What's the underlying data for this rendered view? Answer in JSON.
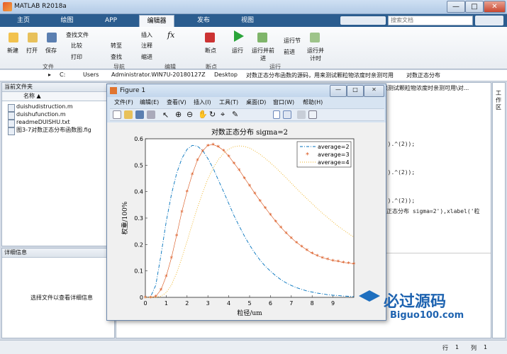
{
  "window": {
    "title": "MATLAB R2018a",
    "minimize": "—",
    "maximize": "□",
    "close": "✕"
  },
  "tabs": [
    {
      "label": "主页",
      "active": false
    },
    {
      "label": "绘图",
      "active": false
    },
    {
      "label": "APP",
      "active": false
    },
    {
      "label": "编辑器",
      "active": true
    },
    {
      "label": "发布",
      "active": false
    },
    {
      "label": "视图",
      "active": false
    }
  ],
  "search_placeholder": "搜索文档",
  "ribbon": {
    "new": "新建",
    "open": "打开",
    "save": "保存",
    "find_files": "查找文件",
    "compare": "比较",
    "print": "打印",
    "goto": "转至",
    "find": "查找",
    "insert": "插入",
    "comment": "注释",
    "indent": "缩进",
    "breakpoint": "断点",
    "run": "运行",
    "run_advance": "运行并前进",
    "run_section": "运行节",
    "advance": "前进",
    "run_time": "运行并计时",
    "groups": {
      "file": "文件",
      "navigate": "导航",
      "edit": "编辑",
      "breakpoints": "断点",
      "run": "运行"
    }
  },
  "address": {
    "parts": [
      "C:",
      "Users",
      "Administrator.WIN7U-20180127Z",
      "Desktop",
      "对数正态分布函数的源码，用来测试颗粒物浓度时亲测可用",
      "对数正态分布"
    ]
  },
  "current_folder": {
    "title": "当前文件夹",
    "column": "名称 ▲",
    "files": [
      "duishudistruction.m",
      "duishufunction.m",
      "readmeDUISHU.txt",
      "图3-7对数正态分布函数图.fig"
    ]
  },
  "details": {
    "title": "详细信息",
    "hint": "选择文件以查看详细信息"
  },
  "editor": {
    "tab_title": "来测试颗粒物浓度时亲测可用\\对...",
    "lines": [
      "d)).^(2));",
      "d)).^(2));",
      "d)).^(2));",
      "数正态分布 sigma=2'),xlabel('粒"
    ]
  },
  "workspace": {
    "label": "工作区"
  },
  "figure": {
    "title": "Figure 1",
    "menus": [
      "文件(F)",
      "编辑(E)",
      "查看(V)",
      "插入(I)",
      "工具(T)",
      "桌面(D)",
      "窗口(W)",
      "帮助(H)"
    ]
  },
  "status": {
    "row_label": "行",
    "row": "1",
    "col_label": "列",
    "col": "1"
  },
  "watermark": {
    "brand": "必过源码",
    "site": "Biguo100.com"
  },
  "chart_data": {
    "type": "line",
    "title": "对数正态分布 sigma=2",
    "xlabel": "粒径/um",
    "ylabel": "权重/100%",
    "xlim": [
      0,
      10
    ],
    "ylim": [
      0,
      0.6
    ],
    "xticks": [
      0,
      1,
      2,
      3,
      4,
      5,
      6,
      7,
      8,
      9
    ],
    "yticks": [
      0,
      0.1,
      0.2,
      0.3,
      0.4,
      0.5,
      0.6
    ],
    "legend_position": "top-right",
    "x": [
      0,
      0.25,
      0.5,
      0.75,
      1,
      1.25,
      1.5,
      1.75,
      2,
      2.25,
      2.5,
      2.75,
      3,
      3.25,
      3.5,
      3.75,
      4,
      4.25,
      4.5,
      4.75,
      5,
      5.25,
      5.5,
      5.75,
      6,
      6.25,
      6.5,
      6.75,
      7,
      7.25,
      7.5,
      7.75,
      8,
      8.25,
      8.5,
      8.75,
      9,
      9.25,
      9.5,
      9.75,
      10
    ],
    "series": [
      {
        "name": "average=2",
        "color": "#0072bd",
        "style": "dashdot",
        "values": [
          0,
          0.0022,
          0.046,
          0.16,
          0.286,
          0.39,
          0.469,
          0.525,
          0.56,
          0.575,
          0.572,
          0.555,
          0.525,
          0.488,
          0.444,
          0.4,
          0.355,
          0.31,
          0.27,
          0.232,
          0.198,
          0.168,
          0.141,
          0.118,
          0.099,
          0.082,
          0.067,
          0.055,
          0.045,
          0.037,
          0.03,
          0.024,
          0.02,
          0.016,
          0.013,
          0.01,
          0.008,
          0.007,
          0.005,
          0.004,
          0.003
        ]
      },
      {
        "name": "average=3",
        "color": "#d95319",
        "style": "star",
        "values": [
          0,
          0.0001,
          0.004,
          0.029,
          0.08,
          0.15,
          0.235,
          0.324,
          0.4,
          0.466,
          0.52,
          0.555,
          0.575,
          0.578,
          0.57,
          0.556,
          0.534,
          0.508,
          0.482,
          0.452,
          0.423,
          0.394,
          0.366,
          0.339,
          0.313,
          0.288,
          0.265,
          0.244,
          0.225,
          0.208,
          0.193,
          0.179,
          0.167,
          0.158,
          0.15,
          0.145,
          0.139,
          0.136,
          0.132,
          0.13,
          0.127
        ]
      },
      {
        "name": "average=4",
        "color": "#edb120",
        "style": "dotted",
        "values": [
          0,
          0,
          0.0003,
          0.0045,
          0.018,
          0.047,
          0.092,
          0.149,
          0.212,
          0.278,
          0.34,
          0.398,
          0.448,
          0.489,
          0.521,
          0.545,
          0.561,
          0.57,
          0.573,
          0.571,
          0.565,
          0.554,
          0.541,
          0.526,
          0.509,
          0.491,
          0.472,
          0.452,
          0.432,
          0.412,
          0.392,
          0.373,
          0.354,
          0.336,
          0.318,
          0.301,
          0.285,
          0.269,
          0.255,
          0.241,
          0.228
        ]
      }
    ]
  }
}
